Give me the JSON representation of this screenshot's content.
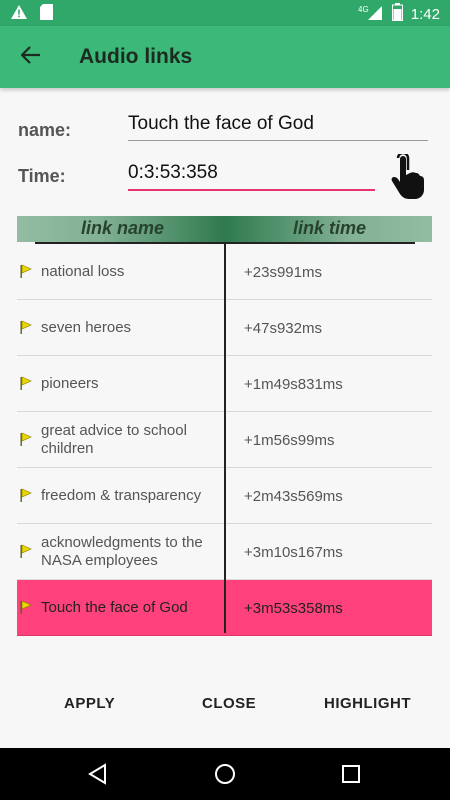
{
  "status_bar": {
    "time": "1:42",
    "network": "4G",
    "icons": [
      "warning-icon",
      "sd-card-icon",
      "signal-icon",
      "battery-icon"
    ]
  },
  "app_bar": {
    "title": "Audio links",
    "back_icon": "arrow-back-icon"
  },
  "form": {
    "name_label": "name:",
    "name_value": "Touch the face of God",
    "time_label": "Time:",
    "time_value": "0:3:53:358",
    "touch_icon": "hand-pointer-icon"
  },
  "table": {
    "headers": {
      "name": "link name",
      "time": "link time"
    },
    "rows": [
      {
        "name": "national loss",
        "time": "+23s991ms",
        "selected": false
      },
      {
        "name": "seven heroes",
        "time": "+47s932ms",
        "selected": false
      },
      {
        "name": "pioneers",
        "time": "+1m49s831ms",
        "selected": false
      },
      {
        "name": "great advice to school children",
        "time": "+1m56s99ms",
        "selected": false
      },
      {
        "name": "freedom & transparency",
        "time": "+2m43s569ms",
        "selected": false
      },
      {
        "name": "acknowledgments to the NASA employees",
        "time": "+3m10s167ms",
        "selected": false
      },
      {
        "name": "Touch the face of God",
        "time": "+3m53s358ms",
        "selected": true
      }
    ]
  },
  "buttons": {
    "apply": "APPLY",
    "close": "CLOSE",
    "highlight": "HIGHLIGHT"
  },
  "nav": {
    "back_icon": "nav-back-icon",
    "home_icon": "nav-home-icon",
    "recent_icon": "nav-recent-icon"
  },
  "colors": {
    "status_bar": "#2fa86a",
    "app_bar": "#3cb878",
    "accent": "#e8336d",
    "selected_row": "#ff417c"
  }
}
